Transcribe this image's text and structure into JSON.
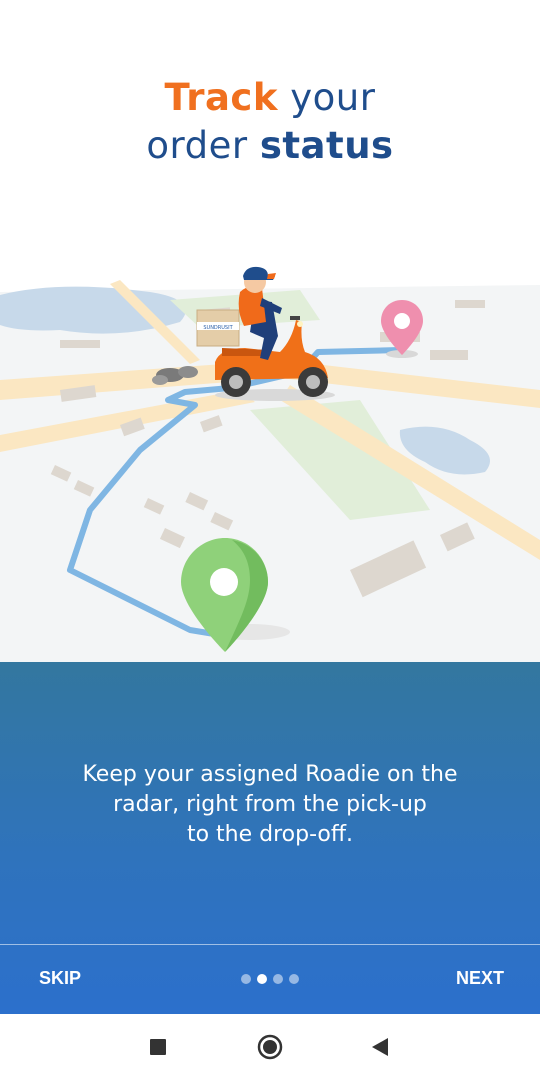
{
  "header": {
    "title_accent": "Track",
    "title_part1": " your",
    "title_part2": "order ",
    "title_strong": "status"
  },
  "illustration": {
    "box_label": "SUNDRUSIT",
    "icons": [
      "delivery-scooter-icon",
      "pickup-pin-icon",
      "dropoff-pin-icon"
    ]
  },
  "onboarding": {
    "description": "Keep your assigned Roadie on the\nradar, right from the pick-up\nto the drop-off.",
    "total_pages": 4,
    "active_page": 2
  },
  "footer": {
    "skip_label": "SKIP",
    "next_label": "NEXT"
  },
  "colors": {
    "accent_orange": "#f0701f",
    "brand_blue": "#1f4d8c",
    "panel_blue": "#2f73bc"
  },
  "system_nav": {
    "icons": [
      "recents-square-icon",
      "home-circle-icon",
      "back-triangle-icon"
    ]
  }
}
